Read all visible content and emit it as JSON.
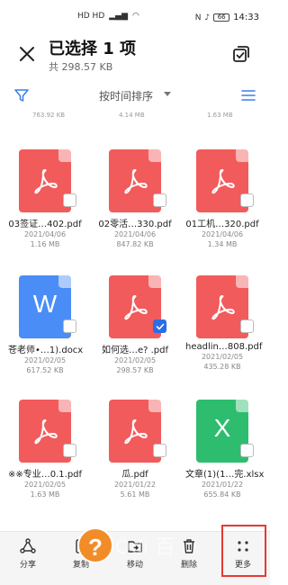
{
  "status_bar": {
    "left_indicators": "HD HD",
    "battery": "66",
    "time": "14:33"
  },
  "header": {
    "title": "已选择 1 项",
    "subtitle": "共 298.57 KB"
  },
  "sort_bar": {
    "label": "按时间排序"
  },
  "previous_row_sizes": [
    "763.92 KB",
    "4.14 MB",
    "1.63 MB"
  ],
  "files": [
    {
      "name": "03签证…402.pdf",
      "date": "2021/04/06",
      "size": "1.16 MB",
      "type": "pdf",
      "selected": false
    },
    {
      "name": "02零活…330.pdf",
      "date": "2021/04/06",
      "size": "847.82 KB",
      "type": "pdf",
      "selected": false
    },
    {
      "name": "01工机…320.pdf",
      "date": "2021/04/06",
      "size": "1.34 MB",
      "type": "pdf",
      "selected": false
    },
    {
      "name": "苍老师•…1).docx",
      "date": "2021/02/05",
      "size": "617.52 KB",
      "type": "doc",
      "icon_letter": "W",
      "selected": false
    },
    {
      "name": "如何选…e? .pdf",
      "date": "2021/02/05",
      "size": "298.57 KB",
      "type": "pdf",
      "selected": true
    },
    {
      "name": "headlin…808.pdf",
      "date": "2021/02/05",
      "size": "435.28 KB",
      "type": "pdf",
      "selected": false
    },
    {
      "name": "※※专业…0.1.pdf",
      "date": "2021/02/05",
      "size": "1.63 MB",
      "type": "pdf",
      "selected": false
    },
    {
      "name": "瓜.pdf",
      "date": "2021/01/22",
      "size": "5.61 MB",
      "type": "pdf",
      "selected": false
    },
    {
      "name": "文章(1)(1…完.xlsx",
      "date": "2021/01/22",
      "size": "655.84 KB",
      "type": "xls",
      "icon_letter": "X",
      "selected": false
    }
  ],
  "bottom_actions": {
    "share": "分享",
    "copy": "复制",
    "move": "移动",
    "delete": "删除",
    "more": "更多"
  },
  "overlay": {
    "help_glyph": "?",
    "watermark": "Odi 百"
  },
  "colors": {
    "pdf": "#f25b5b",
    "doc": "#4a8df6",
    "xls": "#2ebd6e",
    "accent": "#2a6de6",
    "highlight": "#e53935"
  }
}
